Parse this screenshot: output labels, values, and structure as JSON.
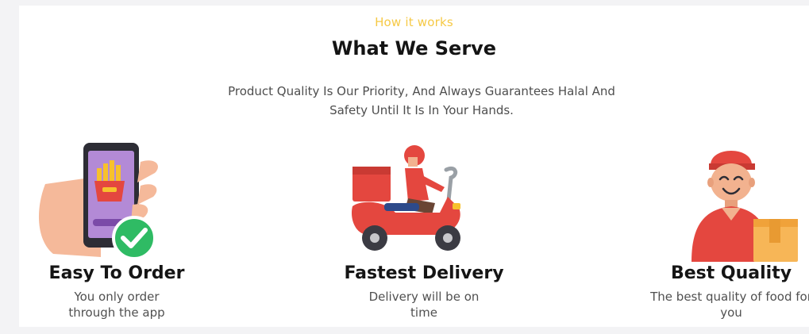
{
  "section": {
    "eyebrow": "How it works",
    "title": "What We Serve",
    "subtitle": "Product Quality Is Our Priority, And Always Guarantees Halal And Safety Until It Is In Your Hands."
  },
  "features": [
    {
      "icon": "phone-order-icon",
      "title": "Easy To Order",
      "description": "You only order through the app"
    },
    {
      "icon": "delivery-scooter-icon",
      "title": "Fastest Delivery",
      "description": "Delivery will be on time"
    },
    {
      "icon": "courier-box-icon",
      "title": "Best Quality",
      "description": "The best quality of food for you"
    }
  ],
  "colors": {
    "accent": "#f6c945",
    "heading": "#141414",
    "body_text": "#4e4e4e",
    "brand_red": "#e4473f",
    "check_green": "#2fbb64"
  }
}
